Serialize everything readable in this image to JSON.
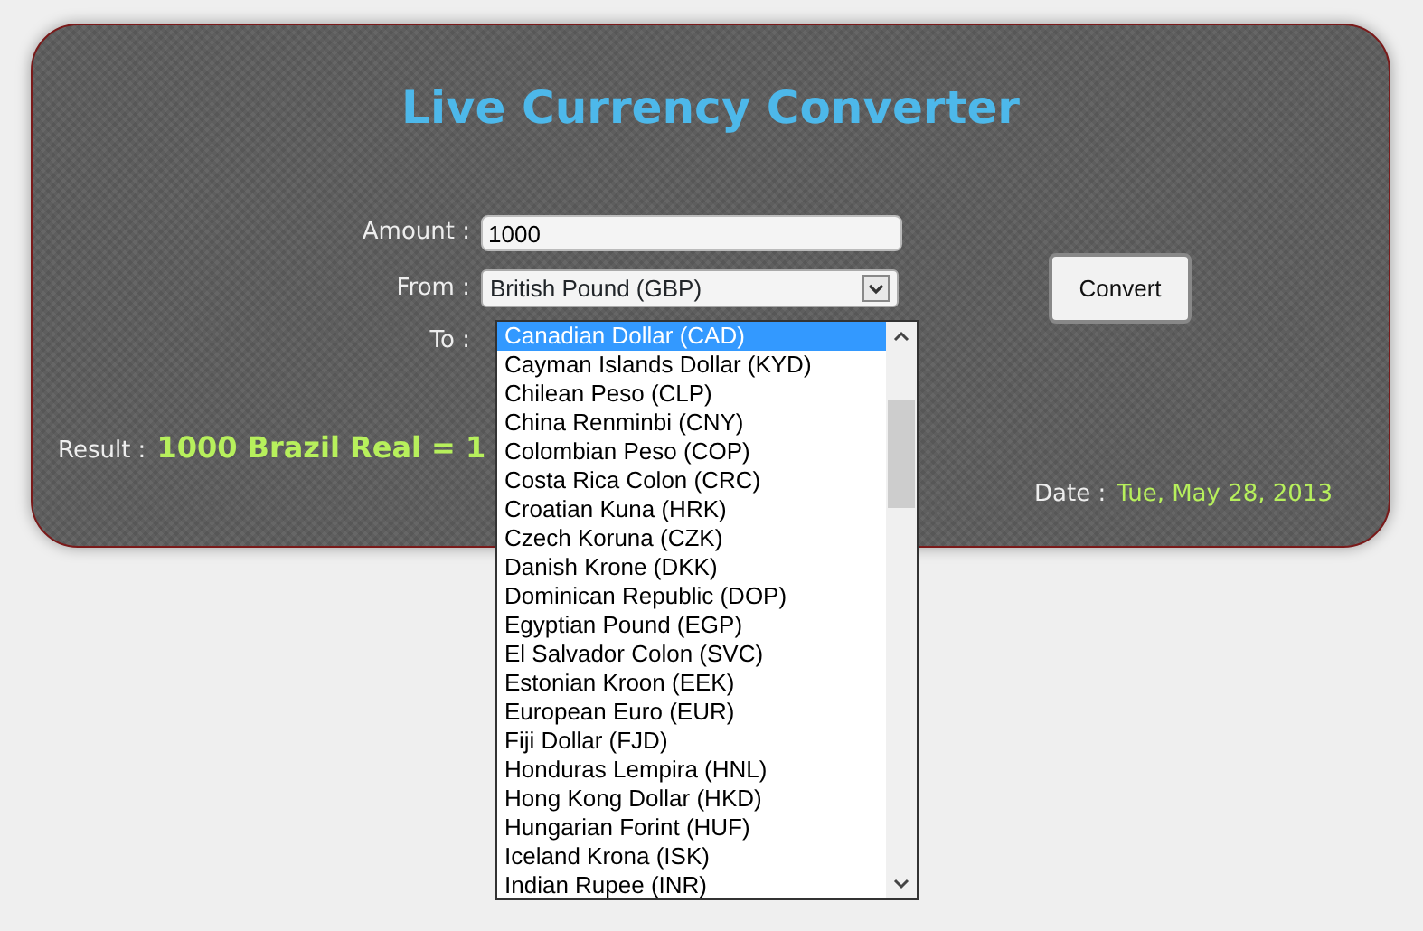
{
  "title": "Live Currency Converter",
  "amount": {
    "label": "Amount :",
    "value": "1000"
  },
  "from": {
    "label": "From :",
    "value": "British Pound (GBP)"
  },
  "to": {
    "label": "To :"
  },
  "convert_button": "Convert",
  "dropdown": {
    "options": [
      {
        "label": "Canadian Dollar (CAD)",
        "selected": true
      },
      {
        "label": "Cayman Islands Dollar (KYD)",
        "selected": false
      },
      {
        "label": "Chilean Peso (CLP)",
        "selected": false
      },
      {
        "label": "China Renminbi (CNY)",
        "selected": false
      },
      {
        "label": "Colombian Peso (COP)",
        "selected": false
      },
      {
        "label": "Costa Rica Colon (CRC)",
        "selected": false
      },
      {
        "label": "Croatian Kuna (HRK)",
        "selected": false
      },
      {
        "label": "Czech Koruna (CZK)",
        "selected": false
      },
      {
        "label": "Danish Krone (DKK)",
        "selected": false
      },
      {
        "label": "Dominican Republic (DOP)",
        "selected": false
      },
      {
        "label": "Egyptian Pound (EGP)",
        "selected": false
      },
      {
        "label": "El Salvador Colon (SVC)",
        "selected": false
      },
      {
        "label": "Estonian Kroon (EEK)",
        "selected": false
      },
      {
        "label": "European Euro (EUR)",
        "selected": false
      },
      {
        "label": "Fiji Dollar (FJD)",
        "selected": false
      },
      {
        "label": "Honduras Lempira (HNL)",
        "selected": false
      },
      {
        "label": "Hong Kong Dollar (HKD)",
        "selected": false
      },
      {
        "label": "Hungarian Forint (HUF)",
        "selected": false
      },
      {
        "label": "Iceland Krona (ISK)",
        "selected": false
      },
      {
        "label": "Indian Rupee (INR)",
        "selected": false
      }
    ]
  },
  "result": {
    "label": "Result :",
    "value": "1000 Brazil Real = 1"
  },
  "date": {
    "label": "Date :",
    "value": "Tue, May 28, 2013"
  }
}
